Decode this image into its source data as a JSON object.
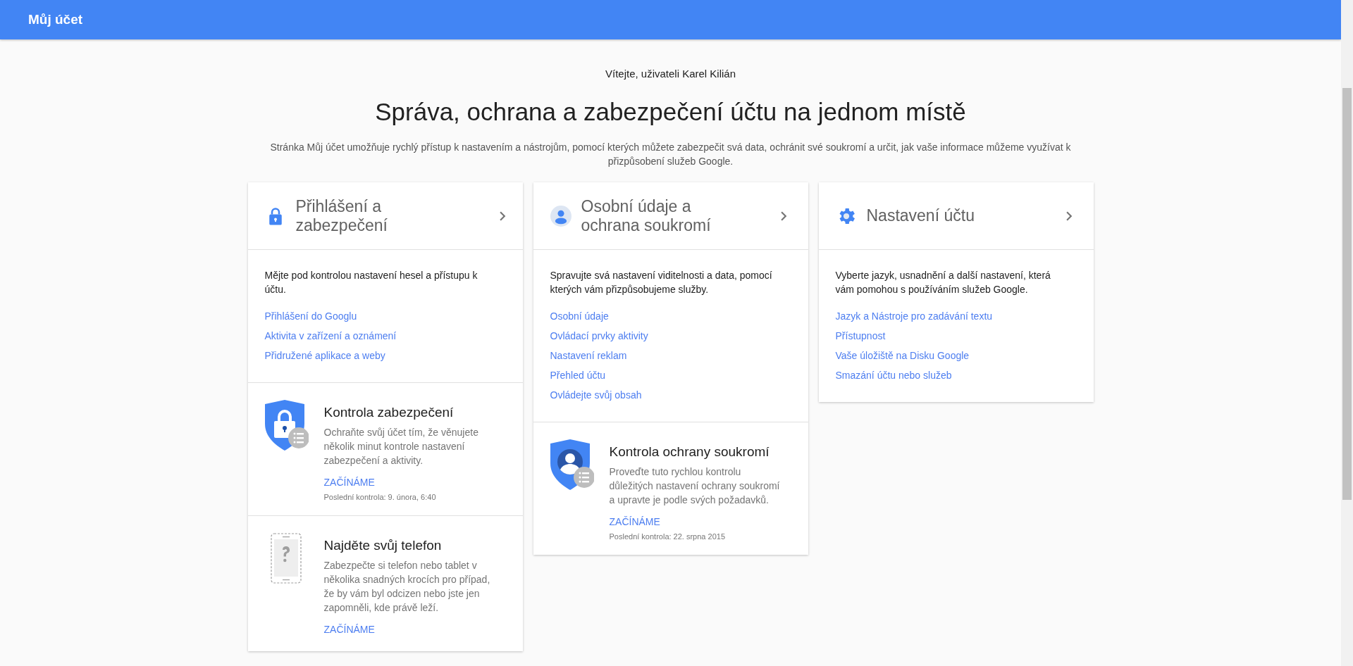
{
  "app_bar": {
    "title": "Můj účet"
  },
  "welcome": "Vítejte, uživateli Karel Kilián",
  "headline": "Správa, ochrana a zabezpečení účtu na jednom místě",
  "intro": "Stránka Můj účet umožňuje rychlý přístup k nastavením a nástrojům, pomocí kterých můžete zabezpečit svá data, ochránit své soukromí a určit, jak vaše informace můžeme využívat k přizpůsobení služeb Google.",
  "cards": [
    {
      "kind": "lock",
      "title": "Přihlášení a zabezpečení",
      "description": "Mějte pod kontrolou nastavení hesel a přístupu k účtu.",
      "links": [
        "Přihlášení do Googlu",
        "Aktivita v zařízení a oznámení",
        "Přidružené aplikace a weby"
      ],
      "features": [
        {
          "kind": "shield-lock",
          "title": "Kontrola zabezpečení",
          "text": "Ochraňte svůj účet tím, že věnujete několik minut kontrole nastavení zabezpečení a aktivity.",
          "action": "ZAČÍNÁME",
          "last_check": "Poslední kontrola: 9. února, 6:40"
        },
        {
          "kind": "phone",
          "title": "Najděte svůj telefon",
          "text": "Zabezpečte si telefon nebo tablet v několika snadných krocích pro případ, že by vám byl odcizen nebo jste jen zapomněli, kde právě leží.",
          "action": "ZAČÍNÁME"
        }
      ]
    },
    {
      "kind": "person",
      "title": "Osobní údaje a ochrana soukromí",
      "description": "Spravujte svá nastavení viditelnosti a data, pomocí kterých vám přizpůsobujeme služby.",
      "links": [
        "Osobní údaje",
        "Ovládací prvky aktivity",
        "Nastavení reklam",
        "Přehled účtu",
        "Ovládejte svůj obsah"
      ],
      "features": [
        {
          "kind": "shield-person",
          "title": "Kontrola ochrany soukromí",
          "text": "Proveďte tuto rychlou kontrolu důležitých nastavení ochrany soukromí a upravte je podle svých požadavků.",
          "action": "ZAČÍNÁME",
          "last_check": "Poslední kontrola: 22. srpna 2015"
        }
      ]
    },
    {
      "kind": "gear",
      "title": "Nastavení účtu",
      "description": "Vyberte jazyk, usnadnění a další nastavení, která vám pomohou s používáním služeb Google.",
      "links": [
        "Jazyk a Nástroje pro zadávání textu",
        "Přístupnost",
        "Vaše úložiště na Disku Google",
        "Smazání účtu nebo služeb"
      ]
    }
  ]
}
